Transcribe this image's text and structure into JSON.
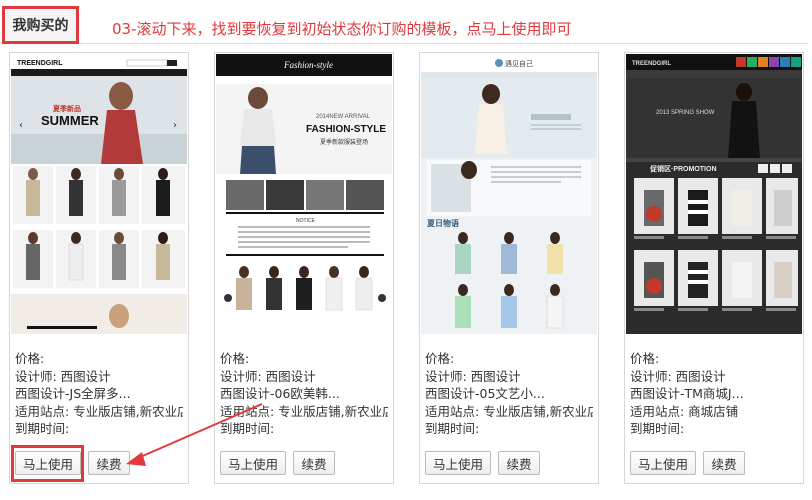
{
  "tab": {
    "label": "我购买的"
  },
  "instruction": "03-滚动下来，找到要恢复到初始状态你订购的模板，点马上使用即可",
  "cards": [
    {
      "price": "价格:",
      "designer": "设计师: 西图设计",
      "name": "西图设计-JS全屏多...",
      "site": "适用站点: 专业版店铺,新农业店铺",
      "expiry": "到期时间:",
      "use_label": "马上使用",
      "renew_label": "续费",
      "thumb": {
        "brand": "TREENDGIRL",
        "banner_small": "夏季新品",
        "banner_big": "SUMMER"
      }
    },
    {
      "price": "价格:",
      "designer": "设计师: 西图设计",
      "name": "西图设计-06欧美韩...",
      "site": "适用站点: 专业版店铺,新农业店铺",
      "expiry": "到期时间:",
      "use_label": "马上使用",
      "renew_label": "续费",
      "thumb": {
        "brand": "Fashion-style",
        "banner_small": "2014NEW ARRIVAL",
        "banner_big": "FASHION-STYLE",
        "banner_sub": "夏季新款服装登场",
        "notice": "NOTICE"
      }
    },
    {
      "price": "价格:",
      "designer": "设计师: 西图设计",
      "name": "西图设计-05文艺小...",
      "site": "适用站点: 专业版店铺,新农业店铺",
      "expiry": "到期时间:",
      "use_label": "马上使用",
      "renew_label": "续费",
      "thumb": {
        "brand": "遇见自己",
        "banner_small": "夏日物语"
      }
    },
    {
      "price": "价格:",
      "designer": "设计师: 西图设计",
      "name": "西图设计-TM商城J...",
      "site": "适用站点: 商城店铺",
      "expiry": "到期时间:",
      "use_label": "马上使用",
      "renew_label": "续费",
      "thumb": {
        "brand": "TREENDGIRL",
        "banner_small": "2013 SPRING SHOW",
        "banner_big": "促销区·PROMOTION"
      }
    }
  ],
  "colors": {
    "accent": "#e0393e",
    "border": "#d6d6d6"
  }
}
